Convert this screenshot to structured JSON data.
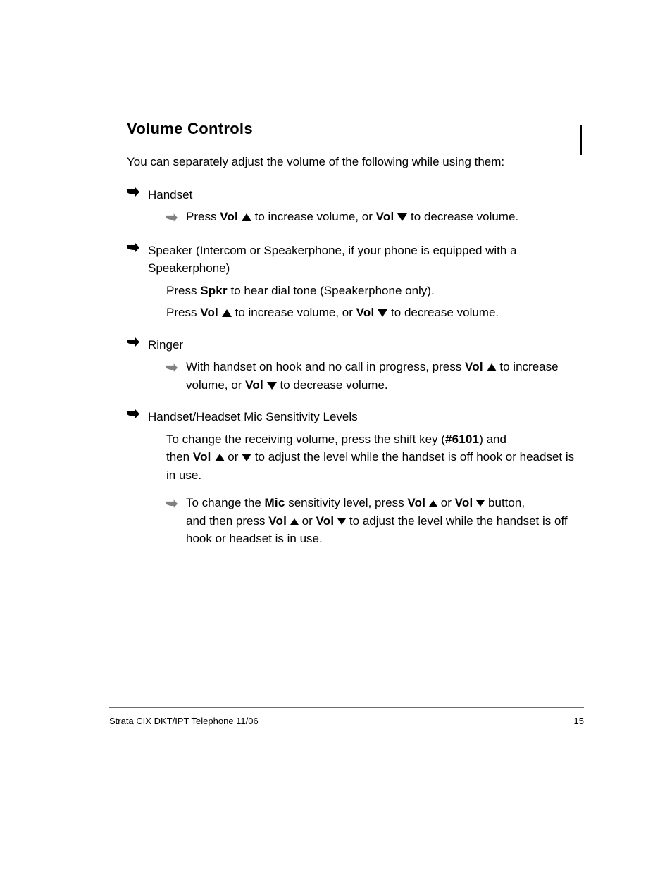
{
  "title": "Volume Controls",
  "subtitle_a": "You can separately adjust the volume of the following while using them:",
  "subtitle_b": "",
  "items": [
    {
      "label": "Handset",
      "sub": {
        "pre": "Press ",
        "k1": "Vol ",
        "mid": " to increase volume, or ",
        "k2": "Vol ",
        "post": " to decrease volume."
      }
    },
    {
      "label": "Speaker (Intercom or Speakerphone, if your phone is equipped with a Speakerphone)",
      "sub": {
        "pre1": "Press ",
        "spkr": "Spkr",
        "pre2": " to hear dial tone (Speakerphone only).",
        "line2_pre": "Press ",
        "k1": "Vol ",
        "line2_mid": " to increase volume, or ",
        "k2": "Vol ",
        "line2_post": " to decrease volume."
      }
    },
    {
      "label": "Ringer",
      "sub": {
        "pre": "With handset on hook and no call in progress, press ",
        "k1": "Vol ",
        "mid": " to increase volume, or ",
        "k2": "Vol ",
        "post": " to decrease volume."
      }
    },
    {
      "label": "Handset/Headset Mic Sensitivity Levels",
      "sub1": {
        "pre": "To change the receiving volume, press the shift key (",
        "code": "#6101",
        "post1": ") and",
        "line2_pre": "then ",
        "k1": "Vol ",
        "sep": " or ",
        "line2_post": " to adjust the level while the handset is off hook or headset is in use."
      },
      "sub2": {
        "pre": "To change the ",
        "mic": "Mic",
        "mid1": " sensitivity level, press ",
        "k1": "Vol ",
        "or": " or ",
        "k2": "Vol ",
        "post1": " button,",
        "line2_pre": "and then press ",
        "k3": "Vol ",
        "or2": " or ",
        "k4": "Vol ",
        "line2_post": " to adjust the level while the handset is off hook or headset is in use."
      }
    }
  ],
  "footer": {
    "left": "Strata CIX DKT/IPT Telephone     11/06",
    "right": "15"
  }
}
